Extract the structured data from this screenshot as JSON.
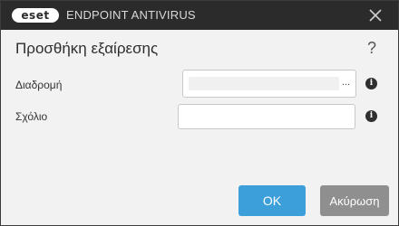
{
  "titlebar": {
    "logo_text": "eset",
    "product_name": "ENDPOINT ANTIVIRUS",
    "close_glyph": "close-icon"
  },
  "dialog": {
    "title": "Προσθήκη εξαίρεσης",
    "help_glyph": "?",
    "path": {
      "label": "Διαδρομή",
      "value": "",
      "browse_label": "..."
    },
    "comment": {
      "label": "Σχόλιο",
      "value": ""
    },
    "info_glyph": "i"
  },
  "buttons": {
    "ok_label": "OK",
    "cancel_label": "Ακύρωση"
  },
  "colors": {
    "titlebar": "#2b2b2b",
    "ok": "#3c9fd9",
    "cancel": "#8f8f8f"
  }
}
